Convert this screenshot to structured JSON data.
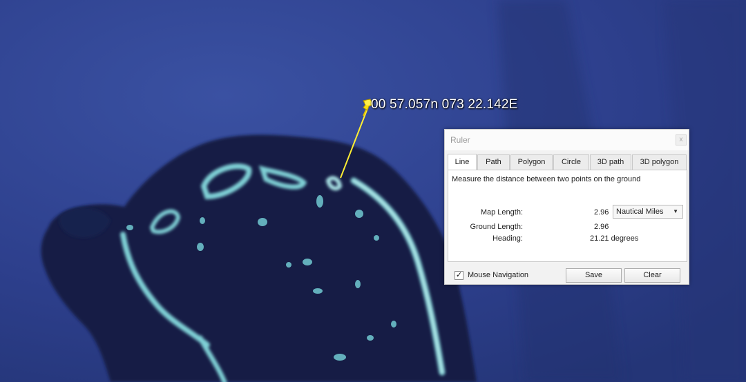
{
  "map": {
    "placemark_label": "00 57.057n 073 22.142E",
    "colors": {
      "ocean": "#2f4290",
      "reef_shadow": "#141f45",
      "reef": "#7fd0d6",
      "ruler_line": "#ffee33"
    },
    "icons": [
      "pushpin-icon"
    ]
  },
  "ruler": {
    "title": "Ruler",
    "close_label": "x",
    "tabs": [
      {
        "label": "Line",
        "active": true
      },
      {
        "label": "Path",
        "active": false
      },
      {
        "label": "Polygon",
        "active": false
      },
      {
        "label": "Circle",
        "active": false
      },
      {
        "label": "3D path",
        "active": false
      },
      {
        "label": "3D polygon",
        "active": false
      }
    ],
    "description": "Measure the distance between two points on the ground",
    "map_length_label": "Map Length:",
    "map_length_value": "2.96",
    "units_selected": "Nautical Miles",
    "ground_length_label": "Ground Length:",
    "ground_length_value": "2.96",
    "heading_label": "Heading:",
    "heading_value": "21.21 degrees",
    "mouse_navigation": {
      "label": "Mouse Navigation",
      "checked": true
    },
    "save_label": "Save",
    "clear_label": "Clear"
  }
}
